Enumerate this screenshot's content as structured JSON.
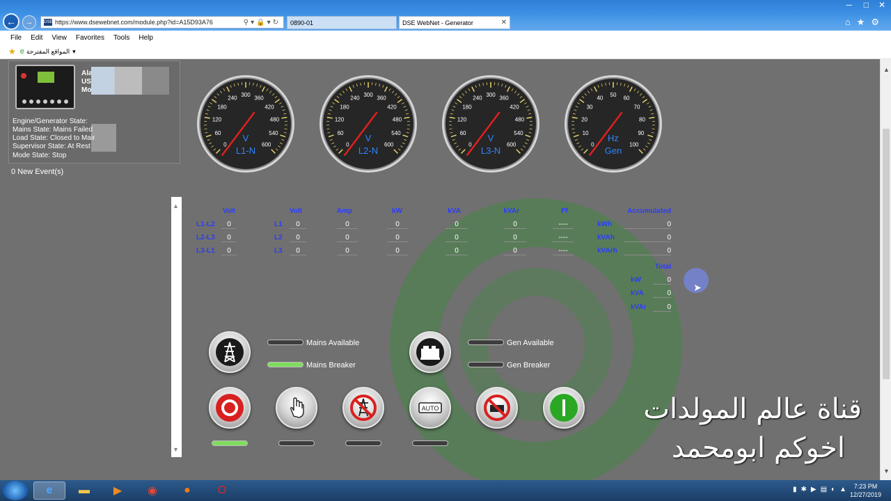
{
  "browser": {
    "url": "https://www.dsewebnet.com/module.php?id=A15D93A76",
    "tabs": [
      {
        "label": "0890-01"
      },
      {
        "label": "DSE WebNet - Generator"
      }
    ],
    "menu": [
      "File",
      "Edit",
      "View",
      "Favorites",
      "Tools",
      "Help"
    ],
    "favorites_label": "المواقع المقترحة"
  },
  "device_panel": {
    "labels": [
      "Ala",
      "US",
      "Mo"
    ],
    "states": [
      "Engine/Generator State:",
      "Mains State: Mains Failed",
      "Load State: Closed to Mains",
      "Supervisor State: At Rest",
      "Mode State: Stop"
    ],
    "events": "0 New Event(s)"
  },
  "gauges": [
    {
      "unit": "V",
      "label": "L1-N",
      "ticks": [
        "0",
        "60",
        "120",
        "180",
        "240",
        "300",
        "360",
        "420",
        "480",
        "540",
        "600"
      ]
    },
    {
      "unit": "V",
      "label": "L2-N",
      "ticks": [
        "0",
        "60",
        "120",
        "180",
        "240",
        "300",
        "360",
        "420",
        "480",
        "540",
        "600"
      ]
    },
    {
      "unit": "V",
      "label": "L3-N",
      "ticks": [
        "0",
        "60",
        "120",
        "180",
        "240",
        "300",
        "360",
        "420",
        "480",
        "540",
        "600"
      ]
    },
    {
      "unit": "Hz",
      "label": "Gen",
      "ticks": [
        "0",
        "10",
        "20",
        "30",
        "40",
        "50",
        "60",
        "70",
        "80",
        "90",
        "100"
      ]
    }
  ],
  "table": {
    "headers": {
      "volt_ll": "Volt",
      "volt": "Volt",
      "amp": "Amp",
      "kw": "kW",
      "kva": "kVA",
      "kvar": "kVAr",
      "pf": "Pf",
      "accumulated": "Accumulated"
    },
    "ll_labels": [
      "L1-L2",
      "L2-L3",
      "L3-L1"
    ],
    "ln_labels": [
      "L1",
      "L2",
      "L3"
    ],
    "rows": [
      {
        "volt_ll": "0",
        "volt": "0",
        "amp": "0",
        "kw": "0",
        "kva": "0",
        "kvar": "0",
        "pf": "----"
      },
      {
        "volt_ll": "0",
        "volt": "0",
        "amp": "0",
        "kw": "0",
        "kva": "0",
        "kvar": "0",
        "pf": "----"
      },
      {
        "volt_ll": "0",
        "volt": "0",
        "amp": "0",
        "kw": "0",
        "kva": "0",
        "kvar": "0",
        "pf": "----"
      }
    ],
    "accumulated": [
      {
        "label": "kWh",
        "value": "0"
      },
      {
        "label": "kVAh",
        "value": "0"
      },
      {
        "label": "kVArh",
        "value": "0"
      }
    ],
    "total_header": "Total",
    "totals": [
      {
        "label": "kW",
        "value": "0"
      },
      {
        "label": "kVA",
        "value": "0"
      },
      {
        "label": "kVAr",
        "value": "0"
      }
    ]
  },
  "status": {
    "mains_available": "Mains Available",
    "mains_breaker": "Mains Breaker",
    "gen_available": "Gen Available",
    "gen_breaker": "Gen Breaker"
  },
  "controls": {
    "auto_label": "AUTO"
  },
  "overlay": {
    "line1": "قناة عالم المولدات",
    "line2": "اخوكم ابومحمد"
  },
  "taskbar": {
    "time": "7:23 PM",
    "date": "12/27/2019"
  }
}
